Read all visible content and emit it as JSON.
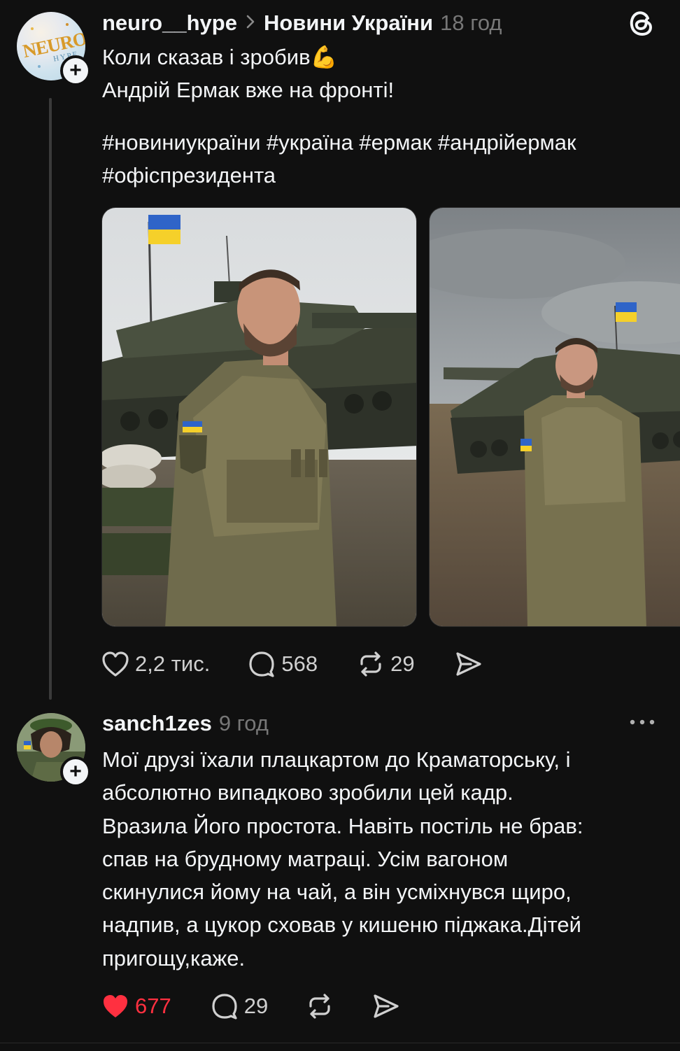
{
  "post": {
    "username": "neuro__hype",
    "community": "Новини України",
    "time": "18 год",
    "avatar_text_main": "NEURO",
    "avatar_text_sub": "HYPE",
    "lines": [
      "Коли сказав і зробив",
      "Андрій Ермак вже на фронті!"
    ],
    "emoji": "💪",
    "hashtags": [
      "#новиниукраїни #україна #ермак #андрійермак",
      "#офіспрезидента"
    ],
    "likes": "2,2 тис.",
    "comments": "568",
    "reposts": "29"
  },
  "reply": {
    "username": "sanch1zes",
    "time": "9 год",
    "lines": [
      "Мої друзі їхали плацкартом до Краматорську, і",
      "абсолютно випадково зробили цей кадр.",
      "Вразила Його простота. Навіть постіль не брав:",
      "спав на брудному матраці. Усім вагоном",
      "скинулися йому на чай, а він усміхнувся щиро,",
      "надпив, а цукор сховав у кишеню піджака.Дітей",
      "пригощу,каже."
    ],
    "likes": "677",
    "comments": "29"
  },
  "colors": {
    "background": "#101010",
    "text": "#f3f5f7",
    "muted": "#777777",
    "like_active": "#ff3040",
    "flag_blue": "#2f64c8",
    "flag_yellow": "#f5d02a"
  },
  "icons": [
    "plus-icon",
    "threads-logo-icon",
    "heart-icon",
    "comment-icon",
    "repost-icon",
    "share-icon",
    "more-icon"
  ]
}
